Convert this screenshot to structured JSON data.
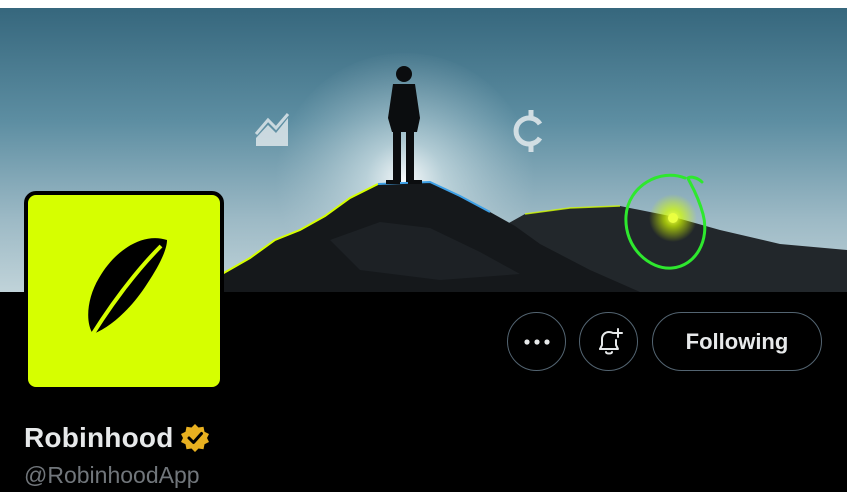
{
  "banner": {
    "alt": "Person standing on a mountain summit at dawn with stock-chart and crypto icons",
    "sky_top": "#36677d",
    "sky_bottom": "#c0d3d9",
    "ridge_highlight": "#d6ff00",
    "icons": [
      "chart-icon",
      "crypto-coin-icon"
    ],
    "annotation_color": "#2ee82e"
  },
  "profile": {
    "display_name": "Robinhood",
    "handle": "@RobinhoodApp",
    "verified": true,
    "verified_badge_color": "#e8b020",
    "avatar_bg": "#d6ff00",
    "avatar_icon": "feather-logo-icon"
  },
  "actions": {
    "more_icon": "more-dots-icon",
    "notify_icon": "bell-plus-icon",
    "following_label": "Following"
  }
}
